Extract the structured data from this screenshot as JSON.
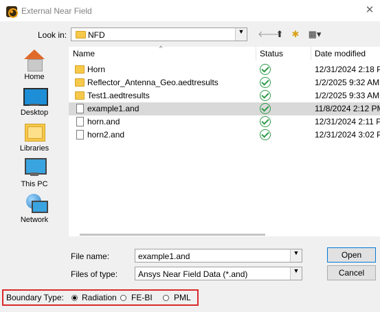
{
  "window": {
    "title": "External Near Field",
    "close_glyph": "✕"
  },
  "lookin": {
    "label": "Look in:",
    "value": "NFD"
  },
  "toolbar": {
    "back_glyph": "🡐",
    "up_glyph": "⬆",
    "newfolder_glyph": "✱",
    "view_glyph": "▦▾"
  },
  "places": [
    {
      "label": "Home",
      "icon": "home-icon"
    },
    {
      "label": "Desktop",
      "icon": "desktop-icon"
    },
    {
      "label": "Libraries",
      "icon": "libraries-icon"
    },
    {
      "label": "This PC",
      "icon": "this-pc-icon"
    },
    {
      "label": "Network",
      "icon": "network-icon"
    }
  ],
  "columns": {
    "name": "Name",
    "status": "Status",
    "date": "Date modified"
  },
  "files": [
    {
      "name": "Horn",
      "type": "folder",
      "date": "12/31/2024 2:18 P"
    },
    {
      "name": "Reflector_Antenna_Geo.aedtresults",
      "type": "folder",
      "date": "1/2/2025 9:32 AM"
    },
    {
      "name": "Test1.aedtresults",
      "type": "folder",
      "date": "1/2/2025 9:33 AM"
    },
    {
      "name": "example1.and",
      "type": "file",
      "date": "11/8/2024 2:12 PM",
      "selected": true
    },
    {
      "name": "horn.and",
      "type": "file",
      "date": "12/31/2024 2:11 P"
    },
    {
      "name": "horn2.and",
      "type": "file",
      "date": "12/31/2024 3:02 P"
    }
  ],
  "filename": {
    "label": "File name:",
    "value": "example1.and"
  },
  "filetype": {
    "label": "Files of type:",
    "value": "Ansys Near Field Data (*.and)"
  },
  "buttons": {
    "open": "Open",
    "cancel": "Cancel"
  },
  "boundary": {
    "label": "Boundary Type:",
    "options": [
      "Radiation",
      "FE-BI",
      "PML"
    ],
    "selected": "Radiation"
  },
  "colors": {
    "highlight_border": "#d9282a",
    "status_check": "#2e9a4a",
    "selected_row": "#d9d9d9"
  }
}
